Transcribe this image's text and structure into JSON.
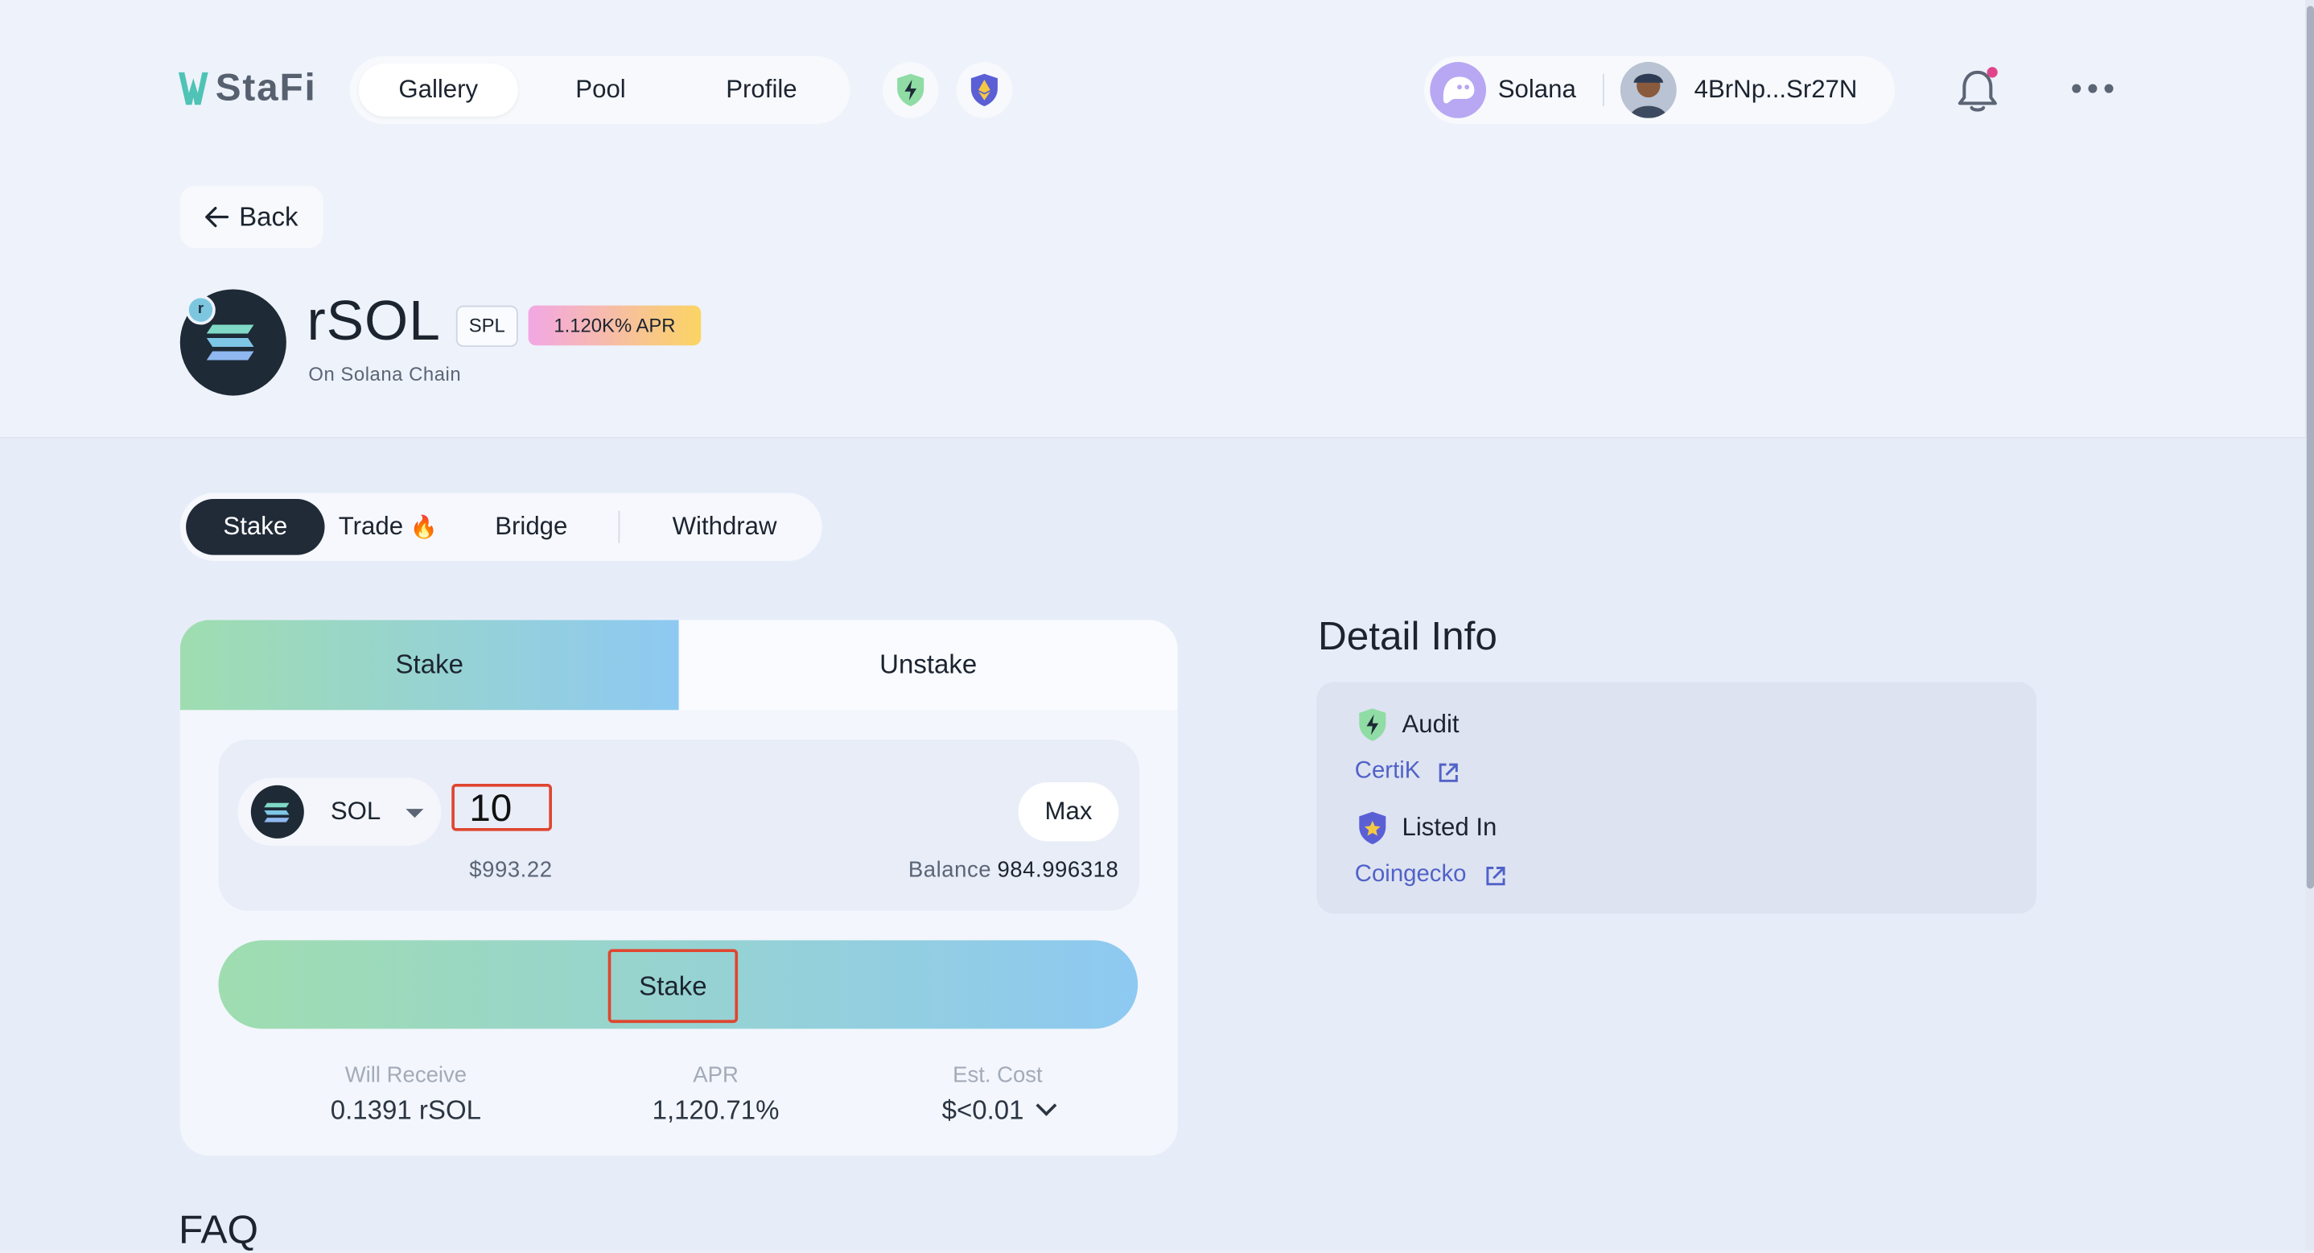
{
  "header": {
    "logo_text": "StaFi",
    "nav": [
      {
        "label": "Gallery",
        "active": true
      },
      {
        "label": "Pool"
      },
      {
        "label": "Profile"
      }
    ],
    "chain_label": "Solana",
    "address_label": "4BrNp...Sr27N",
    "colors": {
      "accent": "#4fc3b5",
      "dark": "#212b38"
    }
  },
  "back": {
    "label": "Back"
  },
  "token": {
    "name": "rSOL",
    "standard": "SPL",
    "apr_badge": "1.120K% APR",
    "chain_note": "On Solana Chain",
    "r_mark": "r"
  },
  "action_tabs": {
    "stake": "Stake",
    "trade": "Trade",
    "trade_icon": "flame-icon",
    "bridge": "Bridge",
    "withdraw": "Withdraw"
  },
  "stake_card": {
    "tab_stake": "Stake",
    "tab_unstake": "Unstake",
    "token_symbol": "SOL",
    "amount": "10",
    "max_label": "Max",
    "usd_value": "$993.22",
    "balance_label": "Balance",
    "balance_value": "984.996318",
    "stake_button": "Stake",
    "stats": {
      "receive_label": "Will Receive",
      "receive_value": "0.1391 rSOL",
      "apr_label": "APR",
      "apr_value": "1,120.71%",
      "cost_label": "Est. Cost",
      "cost_value": "$<0.01"
    }
  },
  "detail": {
    "title": "Detail Info",
    "audit_label": "Audit",
    "audit_link": "CertiK",
    "listed_label": "Listed In",
    "listed_link": "Coingecko"
  },
  "faq_title": "FAQ"
}
